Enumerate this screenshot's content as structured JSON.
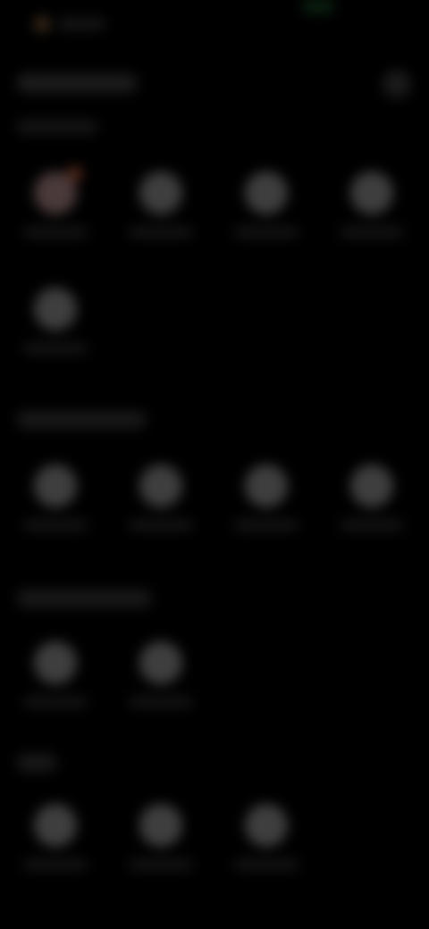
{
  "status_bar": {
    "colors": {
      "indicator": "#3a2a1a",
      "green_indicator": "#0b2410"
    }
  },
  "header": {
    "action_icon": "more-options-icon"
  },
  "sections": [
    {
      "apps": [
        {
          "icon": "app-icon",
          "badge": true
        },
        {
          "icon": "app-icon"
        },
        {
          "icon": "app-icon"
        },
        {
          "icon": "app-icon"
        },
        {
          "icon": "app-icon"
        }
      ]
    },
    {
      "apps": [
        {
          "icon": "app-icon"
        },
        {
          "icon": "app-icon"
        },
        {
          "icon": "app-icon"
        },
        {
          "icon": "app-icon"
        }
      ]
    },
    {
      "apps": [
        {
          "icon": "app-icon"
        },
        {
          "icon": "app-icon"
        }
      ]
    },
    {
      "apps": [
        {
          "icon": "app-icon"
        },
        {
          "icon": "app-icon"
        },
        {
          "icon": "app-icon"
        }
      ]
    }
  ],
  "colors": {
    "background": "#000000",
    "icon": "#3e3e3e",
    "badge": "#5a2a1a"
  }
}
